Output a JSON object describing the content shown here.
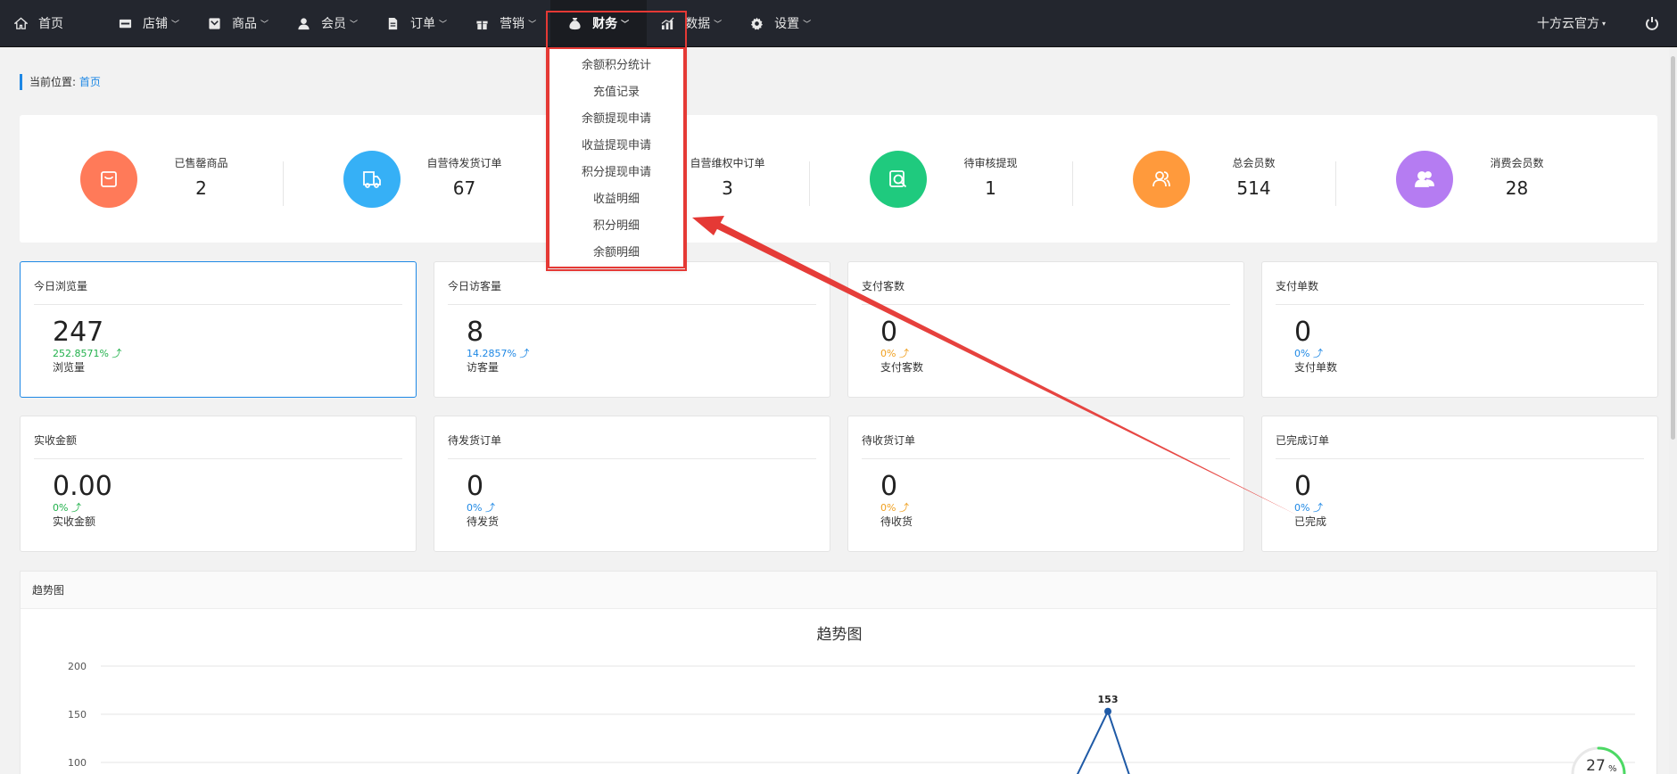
{
  "nav": {
    "home": "首页",
    "items": [
      {
        "label": "店铺",
        "icon": "store-icon"
      },
      {
        "label": "商品",
        "icon": "goods-icon"
      },
      {
        "label": "会员",
        "icon": "member-icon"
      },
      {
        "label": "订单",
        "icon": "order-icon"
      },
      {
        "label": "营销",
        "icon": "gift-icon"
      },
      {
        "label": "财务",
        "icon": "money-bag-icon"
      },
      {
        "label": "数据",
        "icon": "chart-icon"
      },
      {
        "label": "设置",
        "icon": "gear-icon"
      }
    ],
    "user": "十方云官方",
    "power_icon": "power-icon"
  },
  "finance_menu": [
    "余额积分统计",
    "充值记录",
    "余额提现申请",
    "收益提现申请",
    "积分提现申请",
    "收益明细",
    "积分明细",
    "余额明细"
  ],
  "breadcrumb": {
    "prefix": "当前位置:",
    "current": "首页"
  },
  "stats": [
    {
      "label": "已售罄商品",
      "value": "2",
      "color": "#ff7a59",
      "icon": "bag-icon"
    },
    {
      "label": "自营待发货订单",
      "value": "67",
      "color": "#36b0f6",
      "icon": "truck-icon"
    },
    {
      "label": "自营维权中订单",
      "value": "3",
      "color": "#f7b731",
      "icon": "shield-icon"
    },
    {
      "label": "待审核提现",
      "value": "1",
      "color": "#1fca7e",
      "icon": "search-icon"
    },
    {
      "label": "总会员数",
      "value": "514",
      "color": "#ff9a3c",
      "icon": "users-icon"
    },
    {
      "label": "消费会员数",
      "value": "28",
      "color": "#b57cf2",
      "icon": "people-icon"
    }
  ],
  "cards": [
    {
      "title": "今日浏览量",
      "value": "247",
      "pct": "252.8571% ⤴",
      "pct_color": "green",
      "sub": "浏览量"
    },
    {
      "title": "今日访客量",
      "value": "8",
      "pct": "14.2857% ⤴",
      "pct_color": "blue",
      "sub": "访客量"
    },
    {
      "title": "支付客数",
      "value": "0",
      "pct": "0% ⤴",
      "pct_color": "orange",
      "sub": "支付客数"
    },
    {
      "title": "支付单数",
      "value": "0",
      "pct": "0% ⤴",
      "pct_color": "blue",
      "sub": "支付单数"
    },
    {
      "title": "实收金额",
      "value": "0.00",
      "pct": "0% ⤴",
      "pct_color": "green",
      "sub": "实收金额"
    },
    {
      "title": "待发货订单",
      "value": "0",
      "pct": "0% ⤴",
      "pct_color": "blue",
      "sub": "待发货"
    },
    {
      "title": "待收货订单",
      "value": "0",
      "pct": "0% ⤴",
      "pct_color": "orange",
      "sub": "待收货"
    },
    {
      "title": "已完成订单",
      "value": "0",
      "pct": "0% ⤴",
      "pct_color": "blue",
      "sub": "已完成"
    }
  ],
  "trend": {
    "header": "趋势图",
    "progress_value": "27",
    "progress_unit": "%"
  },
  "chart_data": {
    "type": "line",
    "title": "趋势图",
    "yticks": [
      "200",
      "150",
      "100"
    ],
    "ylim": [
      100,
      200
    ],
    "visible_points": [
      {
        "label": "153",
        "y": 153
      }
    ],
    "color": "#1f5aa6"
  }
}
